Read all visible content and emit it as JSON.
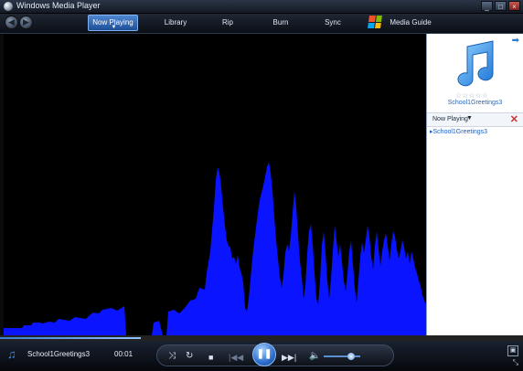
{
  "window": {
    "title": "Windows Media Player",
    "controls": [
      "_",
      "□",
      "×"
    ]
  },
  "nav": {
    "tabs": [
      {
        "label": "Now Playing",
        "active": true
      },
      {
        "label": "Library"
      },
      {
        "label": "Rip"
      },
      {
        "label": "Burn"
      },
      {
        "label": "Sync"
      },
      {
        "label": "Media Guide"
      }
    ]
  },
  "colors": {
    "visualization": "#0a14ff",
    "accent": "#2a7fd0"
  },
  "sidepane": {
    "stars": "☆☆☆☆☆",
    "song_title": "School1Greetings3",
    "now_playing_label": "Now Playing",
    "playlist": [
      "School1Greetings3"
    ]
  },
  "player": {
    "song_title": "School1Greetings3",
    "elapsed": "00:01",
    "seek_progress": 0.27,
    "volume_level": 0.75,
    "icons": {
      "shuffle": "shuffle-icon",
      "repeat": "repeat-icon",
      "stop": "stop-icon",
      "previous": "previous-icon",
      "pause": "pause-icon",
      "next": "next-icon",
      "mute": "speaker-icon"
    }
  }
}
